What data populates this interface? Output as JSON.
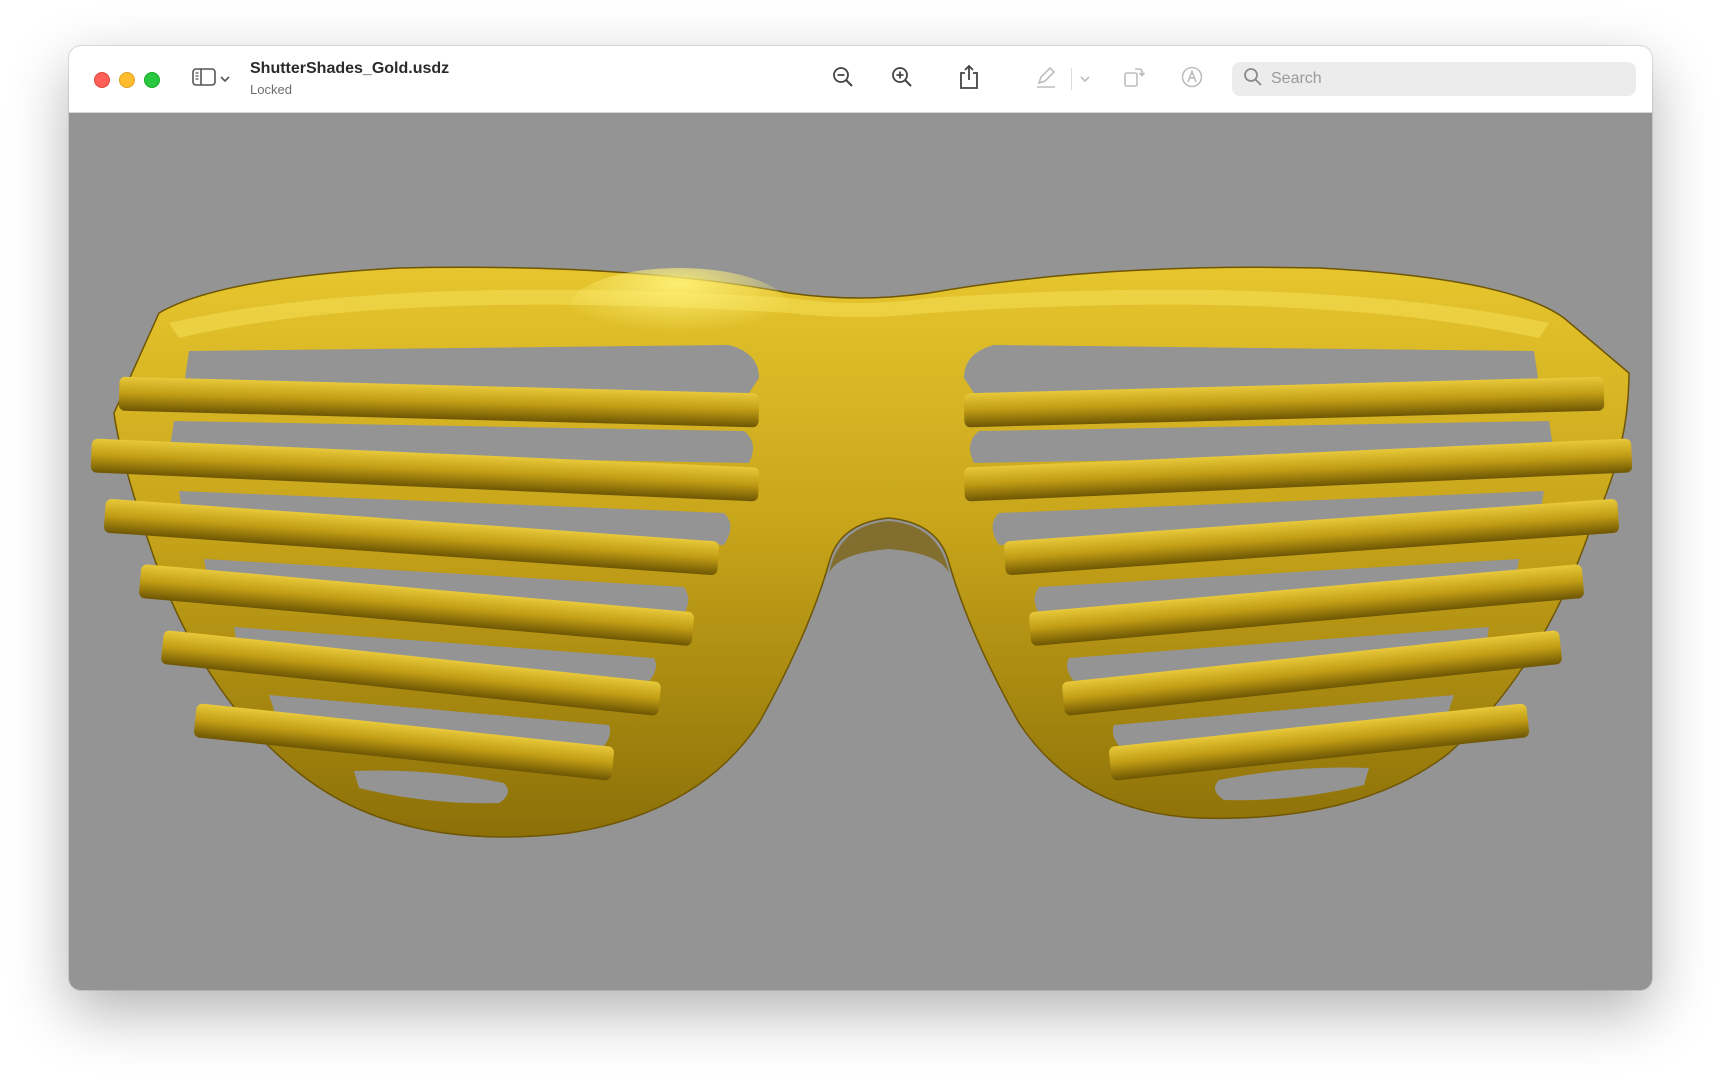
{
  "window": {
    "title": "ShutterShades_Gold.usdz",
    "subtitle": "Locked"
  },
  "toolbar": {
    "buttons": [
      {
        "icon": "zoom-out-icon"
      },
      {
        "icon": "zoom-in-icon"
      },
      {
        "icon": "share-icon"
      },
      {
        "icon": "markup-pen-icon"
      },
      {
        "icon": "chevron-down-icon"
      },
      {
        "icon": "rotate-icon"
      },
      {
        "icon": "markup-circle-a-icon"
      }
    ]
  },
  "search": {
    "placeholder": "Search",
    "value": ""
  },
  "viewer": {
    "object": "gold shutter shades",
    "background_color": "#949494",
    "gold_color": "#c8a51a"
  }
}
